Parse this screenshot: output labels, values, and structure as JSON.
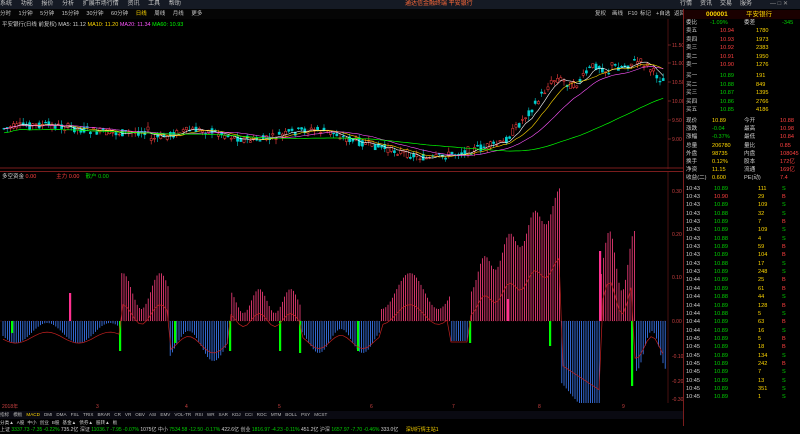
{
  "menubar": {
    "items": [
      "系统",
      "功能",
      "报价",
      "分析",
      "扩展市场行情",
      "资讯",
      "工具",
      "帮助"
    ],
    "notice": "通达信金融终端   平安银行",
    "right_buttons": [
      "行情",
      "资讯",
      "交易",
      "服务"
    ]
  },
  "periodbar": {
    "items": [
      "分时",
      "1分钟",
      "5分钟",
      "15分钟",
      "30分钟",
      "60分钟",
      "日线",
      "周线",
      "月线",
      "更多"
    ],
    "active": "日线",
    "right_items": [
      "复权",
      "画线",
      "F10",
      "标记",
      "+自选",
      "返回"
    ]
  },
  "kline_info": {
    "title": "平安银行(日线 前复权)",
    "ma5": "MA5: 11.12",
    "ma10": "MA10: 11.20",
    "ma20": "MA20: 11.34",
    "ma60": "MA60: 10.93"
  },
  "price_axis": [
    "11.50",
    "11.00",
    "10.50",
    "10.00",
    "9.50",
    "9.00"
  ],
  "price_axis_right": [
    "11.50",
    "11.00",
    "10.50",
    "10.00",
    "9.50",
    "9.00"
  ],
  "indicator_info": {
    "name": "多空资金",
    "v1": "0.00",
    "v2_label": "主力",
    "v2": "0.00",
    "v3_label": "散户",
    "v3": "0.00"
  },
  "ind_axis": [
    "0.30",
    "0.20",
    "0.10",
    "0.00",
    "-0.10",
    "-0.20",
    "-0.30"
  ],
  "date_axis": [
    "2018年",
    "3",
    "4",
    "5",
    "6",
    "7",
    "8",
    "9"
  ],
  "indicator_tabs": [
    "指标",
    "模板",
    "MACD",
    "DMI",
    "DMA",
    "FSL",
    "TRIX",
    "BRAR",
    "CR",
    "VR",
    "OBV",
    "ASI",
    "EMV",
    "VOL-TR",
    "RSI",
    "WR",
    "SAR",
    "KDJ",
    "CCI",
    "ROC",
    "MTM",
    "BOLL",
    "PSY",
    "MCST"
  ],
  "indicator_tabs_selected": "MACD",
  "bottom_tabs": [
    "分类▲",
    "A股",
    "中小",
    "创业",
    "B股",
    "基金▲",
    "债券▲",
    "股转▲",
    "板块指数▲",
    "港美联动▲",
    "自定▲"
  ],
  "statusbar": {
    "sh_label": "上证",
    "sh": "3337.73",
    "sh_chg": "-7.35",
    "sh_pct": "-0.22%",
    "sh_amt": "735.2亿",
    "sz_label": "深证",
    "sz": "11036.7",
    "sz_chg": "-7.95",
    "sz_pct": "-0.07%",
    "sz_amt": "1075亿",
    "zx_label": "中小",
    "zx": "7534.58",
    "zx_chg": "-12.50",
    "zx_pct": "-0.17%",
    "zx_amt": "422.6亿",
    "cy_label": "创业",
    "cy": "1816.97",
    "cy_chg": "-4.23",
    "cy_pct": "-0.11%",
    "cy_amt": "451.2亿",
    "hs_label": "沪深",
    "hs": "1657.97",
    "hs_chg": "-7.70",
    "hs_pct": "-0.46%",
    "hs_amt": "333.0亿",
    "conn": "深圳行情主站1"
  },
  "quote": {
    "code": "000001",
    "name": "平安银行",
    "wei_label": "委比",
    "wei_bi": "-1.09%",
    "wei_cha_label": "委差",
    "wei_cha": "-345",
    "asks": [
      {
        "label": "卖五",
        "price": "10.94",
        "vol": "1780"
      },
      {
        "label": "卖四",
        "price": "10.93",
        "vol": "1973"
      },
      {
        "label": "卖三",
        "price": "10.92",
        "vol": "2383"
      },
      {
        "label": "卖二",
        "price": "10.91",
        "vol": "1950"
      },
      {
        "label": "卖一",
        "price": "10.90",
        "vol": "1276"
      }
    ],
    "bids": [
      {
        "label": "买一",
        "price": "10.89",
        "vol": "191"
      },
      {
        "label": "买二",
        "price": "10.88",
        "vol": "849"
      },
      {
        "label": "买三",
        "price": "10.87",
        "vol": "1395"
      },
      {
        "label": "买四",
        "price": "10.86",
        "vol": "2766"
      },
      {
        "label": "买五",
        "price": "10.85",
        "vol": "4186"
      }
    ],
    "stats": [
      {
        "l1": "现价",
        "v1": "10.89",
        "l2": "今开",
        "v2": "10.88"
      },
      {
        "l1": "涨跌",
        "v1": "-0.04",
        "l2": "最高",
        "v2": "10.98"
      },
      {
        "l1": "涨幅",
        "v1": "-0.37%",
        "l2": "最低",
        "v2": "10.84"
      },
      {
        "l1": "总量",
        "v1": "206780",
        "l2": "量比",
        "v2": "0.85"
      },
      {
        "l1": "外盘",
        "v1": "98735",
        "l2": "内盘",
        "v2": "108045"
      },
      {
        "l1": "换手",
        "v1": "0.12%",
        "l2": "股本",
        "v2": "172亿"
      },
      {
        "l1": "净资",
        "v1": "11.15",
        "l2": "流通",
        "v2": "169亿"
      },
      {
        "l1": "收益(二)",
        "v1": "0.600",
        "l2": "PE(动)",
        "v2": "7.4"
      }
    ],
    "ticks": [
      {
        "t": "10:43",
        "p": "10.89",
        "v": "111",
        "d": "S"
      },
      {
        "t": "10:43",
        "p": "10.90",
        "v": "29",
        "d": "B"
      },
      {
        "t": "10:43",
        "p": "10.89",
        "v": "109",
        "d": "S"
      },
      {
        "t": "10:43",
        "p": "10.88",
        "v": "32",
        "d": "S"
      },
      {
        "t": "10:43",
        "p": "10.89",
        "v": "7",
        "d": "B"
      },
      {
        "t": "10:43",
        "p": "10.89",
        "v": "109",
        "d": "S"
      },
      {
        "t": "10:43",
        "p": "10.88",
        "v": "4",
        "d": "S"
      },
      {
        "t": "10:43",
        "p": "10.89",
        "v": "59",
        "d": "B"
      },
      {
        "t": "10:43",
        "p": "10.89",
        "v": "104",
        "d": "B"
      },
      {
        "t": "10:43",
        "p": "10.88",
        "v": "17",
        "d": "S"
      },
      {
        "t": "10:43",
        "p": "10.89",
        "v": "248",
        "d": "S"
      },
      {
        "t": "10:44",
        "p": "10.89",
        "v": "25",
        "d": "B"
      },
      {
        "t": "10:44",
        "p": "10.89",
        "v": "61",
        "d": "B"
      },
      {
        "t": "10:44",
        "p": "10.88",
        "v": "44",
        "d": "S"
      },
      {
        "t": "10:44",
        "p": "10.89",
        "v": "128",
        "d": "B"
      },
      {
        "t": "10:44",
        "p": "10.88",
        "v": "5",
        "d": "S"
      },
      {
        "t": "10:44",
        "p": "10.89",
        "v": "63",
        "d": "B"
      },
      {
        "t": "10:44",
        "p": "10.89",
        "v": "16",
        "d": "S"
      },
      {
        "t": "10:45",
        "p": "10.89",
        "v": "5",
        "d": "B"
      },
      {
        "t": "10:45",
        "p": "10.89",
        "v": "18",
        "d": "B"
      },
      {
        "t": "10:45",
        "p": "10.89",
        "v": "134",
        "d": "S"
      },
      {
        "t": "10:45",
        "p": "10.89",
        "v": "242",
        "d": "B"
      },
      {
        "t": "10:45",
        "p": "10.89",
        "v": "7",
        "d": "S"
      },
      {
        "t": "10:45",
        "p": "10.89",
        "v": "13",
        "d": "S"
      },
      {
        "t": "10:45",
        "p": "10.89",
        "v": "351",
        "d": "S"
      },
      {
        "t": "10:45",
        "p": "10.89",
        "v": "1",
        "d": "S"
      }
    ]
  },
  "colors": {
    "up": "#ff4040",
    "down": "#00d0d0",
    "ma5": "#ffffff",
    "ma10": "#ffd700",
    "ma20": "#ff55ff",
    "ma60": "#00ff00",
    "ind_pos": "#ff4080",
    "ind_neg": "#4080ff",
    "ind_signal": "#00ff00"
  }
}
